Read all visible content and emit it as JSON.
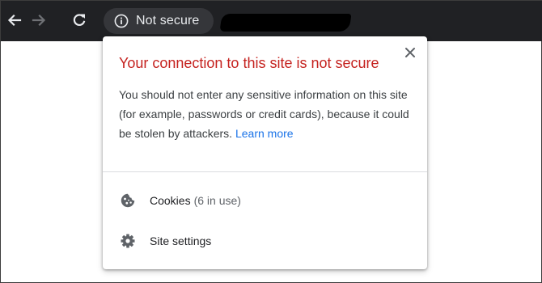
{
  "toolbar": {
    "back_icon": "back-arrow-icon",
    "forward_icon": "forward-arrow-icon",
    "reload_icon": "reload-icon",
    "security_chip": {
      "icon": "info-icon",
      "label": "Not secure"
    }
  },
  "popup": {
    "title": "Your connection to this site is not secure",
    "message": "You should not enter any sensitive information on this site (for example, passwords or credit cards), because it could be stolen by attackers.",
    "learn_more": "Learn more",
    "close_icon": "close-icon",
    "items": [
      {
        "icon": "cookie-icon",
        "label": "Cookies",
        "sub": "(6 in use)"
      },
      {
        "icon": "gear-icon",
        "label": "Site settings",
        "sub": ""
      }
    ]
  },
  "colors": {
    "toolbar_bg": "#202124",
    "chip_bg": "#35363a",
    "title_red": "#c5221f",
    "link_blue": "#1a73e8"
  }
}
